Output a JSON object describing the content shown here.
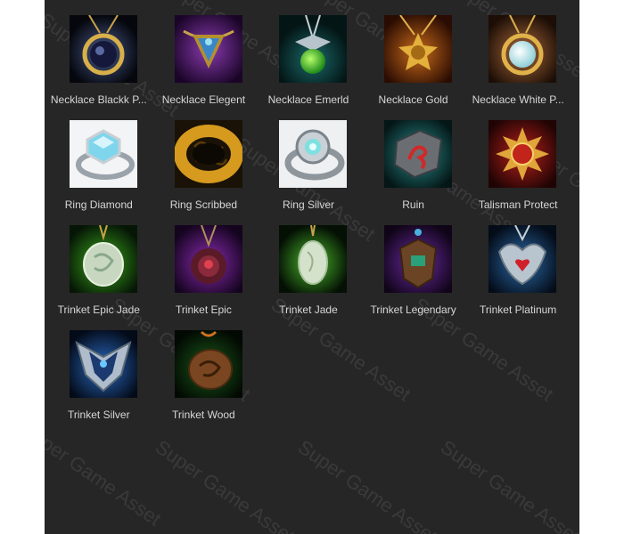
{
  "watermark": "Super Game Asset",
  "items": [
    {
      "label": "Necklace Blackk P...",
      "icon": "necklace-black-pearl-icon"
    },
    {
      "label": "Necklace Elegent",
      "icon": "necklace-elegant-icon"
    },
    {
      "label": "Necklace Emerld",
      "icon": "necklace-emerald-icon"
    },
    {
      "label": "Necklace Gold",
      "icon": "necklace-gold-icon"
    },
    {
      "label": "Necklace White P...",
      "icon": "necklace-white-pearl-icon"
    },
    {
      "label": "Ring Diamond",
      "icon": "ring-diamond-icon"
    },
    {
      "label": "Ring Scribbed",
      "icon": "ring-scribbed-icon"
    },
    {
      "label": "Ring Silver",
      "icon": "ring-silver-icon"
    },
    {
      "label": "Ruin",
      "icon": "ruin-stone-icon"
    },
    {
      "label": "Talisman Protect",
      "icon": "talisman-protect-icon"
    },
    {
      "label": "Trinket Epic Jade",
      "icon": "trinket-epic-jade-icon"
    },
    {
      "label": "Trinket Epic",
      "icon": "trinket-epic-icon"
    },
    {
      "label": "Trinket Jade",
      "icon": "trinket-jade-icon"
    },
    {
      "label": "Trinket Legendary",
      "icon": "trinket-legendary-icon"
    },
    {
      "label": "Trinket Platinum",
      "icon": "trinket-platinum-icon"
    },
    {
      "label": "Trinket Silver",
      "icon": "trinket-silver-icon"
    },
    {
      "label": "Trinket Wood",
      "icon": "trinket-wood-icon"
    }
  ]
}
